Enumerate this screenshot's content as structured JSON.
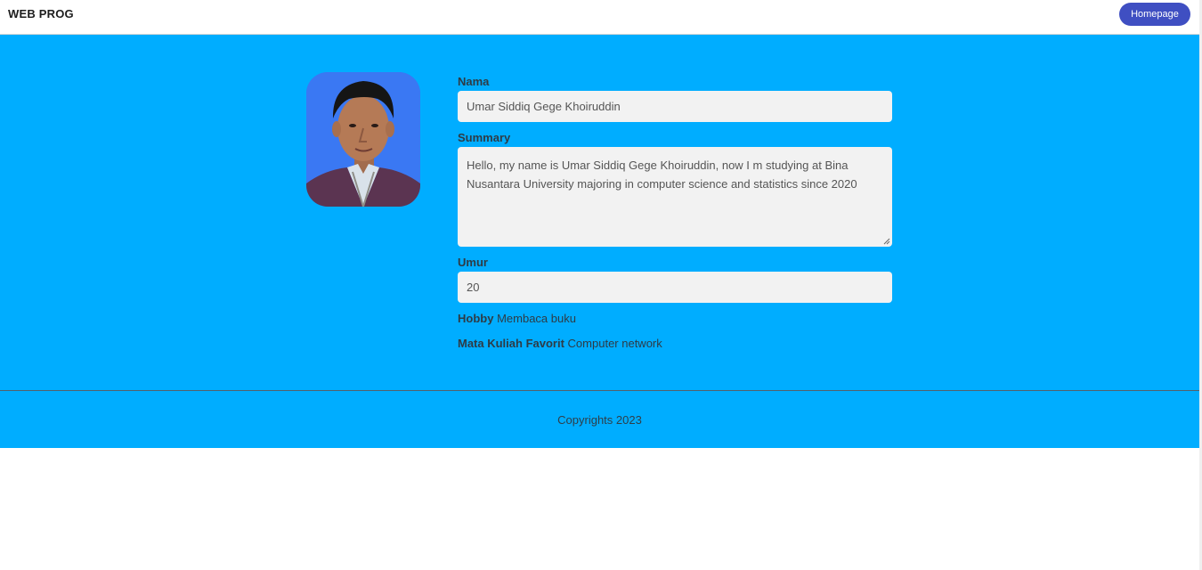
{
  "navbar": {
    "brand": "WEB PROG",
    "home_button": "Homepage"
  },
  "profile": {
    "avatar_alt": "profile photo",
    "nama_label": "Nama",
    "nama_value": "Umar Siddiq Gege Khoiruddin",
    "summary_label": "Summary",
    "summary_value": "Hello, my name is Umar Siddiq Gege Khoiruddin, now I m studying at Bina Nusantara University majoring in computer science and statistics since 2020",
    "umur_label": "Umur",
    "umur_value": "20",
    "hobby_label": "Hobby",
    "hobby_value": "Membaca buku",
    "matkul_label": "Mata Kuliah Favorit",
    "matkul_value": "Computer network"
  },
  "footer": {
    "text": "Copyrights 2023"
  },
  "colors": {
    "main_bg": "#00adff",
    "button_bg": "#3f4fc2",
    "avatar_bg": "#3a78f3",
    "field_bg": "#f2f2f2"
  }
}
